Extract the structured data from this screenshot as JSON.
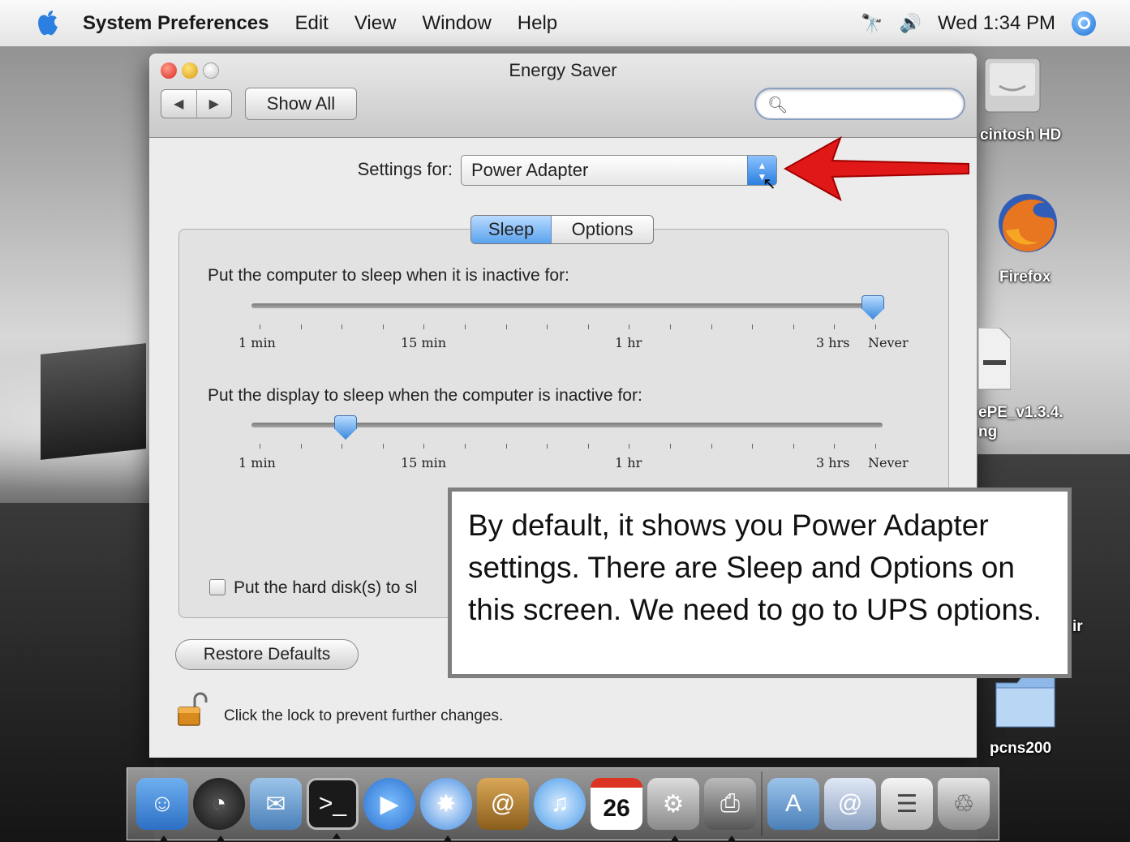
{
  "menubar": {
    "apple_icon": "apple-icon",
    "items": [
      "System Preferences",
      "Edit",
      "View",
      "Window",
      "Help"
    ],
    "clock": "Wed 1:34 PM",
    "status_icons": [
      "binoculars-icon",
      "volume-icon",
      "spotlight-icon"
    ]
  },
  "window": {
    "title": "Energy Saver",
    "nav_back": "◀",
    "nav_forward": "▶",
    "show_all": "Show All",
    "search_placeholder": "",
    "settings_for_label": "Settings for:",
    "settings_for_value": "Power Adapter",
    "tabs": [
      "Sleep",
      "Options"
    ],
    "selected_tab": "Sleep",
    "computer_sleep": {
      "label": "Put the computer to sleep when it is inactive for:",
      "tick_labels": [
        "1 min",
        "15 min",
        "1 hr",
        "3 hrs",
        "Never"
      ],
      "value": "Never"
    },
    "display_sleep": {
      "label": "Put the display to sleep when the computer is inactive for:",
      "tick_labels": [
        "1 min",
        "15 min",
        "1 hr",
        "3 hrs",
        "Never"
      ],
      "value_fraction": 0.15
    },
    "hard_disk_label": "Put the hard disk(s) to sl",
    "hard_disk_checked": false,
    "restore_defaults": "Restore Defaults",
    "lock_text": "Click the lock to prevent further changes."
  },
  "callout": {
    "text": "By default, it shows you Power Adapter settings. There are Sleep and Options on this screen. We need to go to UPS options."
  },
  "desktop_icons": [
    {
      "label": "cintosh HD",
      "icon": "hard-drive-icon"
    },
    {
      "label": "Firefox",
      "icon": "firefox-icon"
    },
    {
      "label": "ePE_v1.3.4.",
      "icon": "document-icon"
    },
    {
      "label": "ng",
      "icon": "document-icon"
    },
    {
      "label": "ir",
      "icon": "file-icon"
    },
    {
      "label": "pcns200",
      "icon": "folder-icon"
    }
  ],
  "dock": {
    "items": [
      "finder-icon",
      "dashboard-icon",
      "mail-icon",
      "terminal-icon",
      "ichat-icon",
      "safari-icon",
      "address-book-icon",
      "itunes-icon",
      "ical-icon",
      "system-preferences-icon",
      "printer-icon",
      "applications-icon",
      "internet-icon",
      "documents-icon",
      "trash-icon"
    ],
    "calendar_day": "26"
  },
  "colors": {
    "accent_blue": "#3f8ae0",
    "arrow_red": "#e01818",
    "callout_border": "#7f7f7f"
  }
}
